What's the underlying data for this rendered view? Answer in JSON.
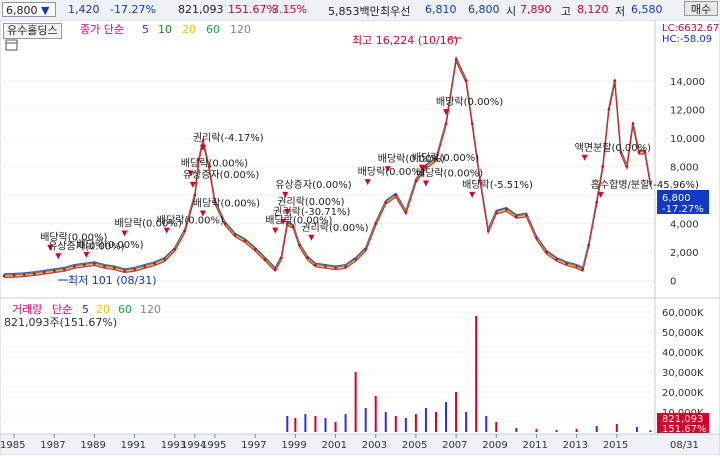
{
  "toolbar": {
    "price": "6,800",
    "change": "1,420",
    "change_pct": "-17.27%",
    "volume": "821,093",
    "vol_ratio": "151.67%",
    "turnover": "3.15%",
    "amount": "5,853백만",
    "bid_label": "최우선",
    "bid1": "6,810",
    "bid2": "6,800",
    "open_label": "시",
    "open": "7,890",
    "high_label": "고",
    "high": "8,120",
    "low_label": "저",
    "low": "6,580"
  },
  "buy_button": "매수",
  "stock_name": "유수홀딩스",
  "legend": {
    "price_title": "종가 단순",
    "ma": [
      "5",
      "10",
      "20",
      "60",
      "120"
    ],
    "ma_colors": [
      "#2f2fe0",
      "#1a8a1a",
      "#e3c600",
      "#16a34a",
      "#888888"
    ],
    "volume_title": "거래량",
    "volume_ma_label": "단순",
    "volume_ma": [
      "5",
      "20",
      "60",
      "120"
    ],
    "volume_summary": "821,093주(151.67%)"
  },
  "lc_hc": {
    "lc": "LC:6632.67",
    "hc": "HC:-58.09"
  },
  "current_price_tag": {
    "price": "6,800",
    "pct": "-17.27%"
  },
  "current_volume_tag": {
    "value": "821,093",
    "pct": "151.67%"
  },
  "annotations": {
    "high": "최고 16,224 (10/16)",
    "low": "최저 101 (08/31)",
    "events": [
      {
        "text": "권리락(-4.17%)",
        "year": 1994.4,
        "price": 9800
      },
      {
        "text": "배당락(0.00%)",
        "year": 1993.8,
        "price": 8000
      },
      {
        "text": "유상증자(0.00%)",
        "year": 1993.9,
        "price": 7200
      },
      {
        "text": "배당락(0.00%)",
        "year": 1994.4,
        "price": 5200
      },
      {
        "text": "배당락(0.00%)",
        "year": 1992.6,
        "price": 4000
      },
      {
        "text": "배당락(0.00%)",
        "year": 1990.5,
        "price": 3800
      },
      {
        "text": "배당락(0.00%)",
        "year": 1986.8,
        "price": 2800
      },
      {
        "text": "유상증자(0.00%)",
        "year": 1987.2,
        "price": 2200
      },
      {
        "text": "배당락(0.00%)",
        "year": 1988.6,
        "price": 2300
      },
      {
        "text": "유상증자(0.00%)",
        "year": 1998.5,
        "price": 6500
      },
      {
        "text": "권리락(0.00%)",
        "year": 1998.6,
        "price": 5300
      },
      {
        "text": "권리락(-30.71%)",
        "year": 1998.4,
        "price": 4600
      },
      {
        "text": "배당락(0.00%)",
        "year": 1998.0,
        "price": 4000
      },
      {
        "text": "권리락(0.00%)",
        "year": 1999.8,
        "price": 3500
      },
      {
        "text": "배당락(0.00%)",
        "year": 2002.6,
        "price": 7400
      },
      {
        "text": "배당락(0.00%)",
        "year": 2003.6,
        "price": 8300
      },
      {
        "text": "배당락(0.00%)",
        "year": 2005.3,
        "price": 8400
      },
      {
        "text": "배당락(0.00%)",
        "year": 2005.5,
        "price": 7300
      },
      {
        "text": "배당락(0.00%)",
        "year": 2006.5,
        "price": 12300
      },
      {
        "text": "배당락(-5.51%)",
        "year": 2007.8,
        "price": 6500
      },
      {
        "text": "흡수합병/분할(-45.96%)",
        "year": 2014.2,
        "price": 6500
      },
      {
        "text": "액면분할(0.00%)",
        "year": 2013.4,
        "price": 9100
      }
    ]
  },
  "chart_data": {
    "type": "line",
    "title": "",
    "x_label_years": [
      "1985",
      "1987",
      "1989",
      "1991",
      "1993",
      "1994",
      "1995",
      "1997",
      "1999",
      "2001",
      "2003",
      "2005",
      "2007",
      "2009",
      "2011",
      "2013",
      "2015"
    ],
    "x_last_label": "08/31",
    "price_axis": {
      "ticks": [
        0,
        2000,
        4000,
        6000,
        8000,
        10000,
        12000,
        14000
      ],
      "labels": [
        "0",
        "2,000",
        "4,000",
        "6,000",
        "8,000",
        "10,000",
        "12,000",
        "14,000"
      ],
      "range": [
        -1000,
        17000
      ]
    },
    "volume_axis": {
      "ticks": [
        5000000,
        10000000,
        20000000,
        30000000,
        40000000,
        50000000,
        60000000
      ],
      "labels": [
        "5,000K",
        "10,000K",
        "20,000K",
        "30,000K",
        "40,000K",
        "50,000K",
        "60,000K"
      ],
      "range": [
        0,
        66000000
      ]
    },
    "price_series": {
      "name": "",
      "x": [
        1984.5,
        1985.0,
        1985.5,
        1986.0,
        1986.5,
        1987.0,
        1987.5,
        1988.0,
        1988.5,
        1989.0,
        1989.5,
        1990.0,
        1990.5,
        1991.0,
        1991.5,
        1992.0,
        1992.5,
        1993.0,
        1993.5,
        1994.0,
        1994.2,
        1994.4,
        1994.7,
        1995.0,
        1995.5,
        1996.0,
        1996.5,
        1997.0,
        1997.5,
        1998.0,
        1998.3,
        1998.6,
        1998.9,
        1999.2,
        1999.6,
        2000.0,
        2000.5,
        2001.0,
        2001.5,
        2002.0,
        2002.5,
        2003.0,
        2003.5,
        2004.0,
        2004.5,
        2005.0,
        2005.5,
        2006.0,
        2006.5,
        2007.0,
        2007.5,
        2007.8,
        2008.2,
        2008.6,
        2009.0,
        2009.5,
        2010.0,
        2010.5,
        2011.0,
        2011.5,
        2012.0,
        2012.5,
        2013.0,
        2013.3,
        2013.6,
        2014.0,
        2014.3,
        2014.6,
        2014.9,
        2015.2,
        2015.5,
        2015.8,
        2016.1,
        2016.4,
        2016.67
      ],
      "y": [
        350,
        380,
        420,
        500,
        600,
        700,
        800,
        1000,
        1100,
        1200,
        1000,
        900,
        700,
        800,
        1000,
        1200,
        1500,
        2200,
        3500,
        6000,
        8500,
        9800,
        8000,
        5500,
        4000,
        3200,
        2800,
        2200,
        1500,
        800,
        1600,
        4000,
        3800,
        2500,
        1600,
        1100,
        1000,
        900,
        1000,
        1500,
        2200,
        4000,
        5500,
        6000,
        4800,
        7000,
        8000,
        8500,
        11000,
        15500,
        14000,
        11000,
        7000,
        3500,
        4800,
        5000,
        4500,
        4600,
        3000,
        2000,
        1500,
        1200,
        1000,
        800,
        2500,
        5500,
        8000,
        12000,
        14000,
        9000,
        8000,
        11000,
        9000,
        9000,
        6800
      ]
    },
    "volume_series": {
      "name": "",
      "x": [
        1998.6,
        1999.0,
        1999.5,
        2000.0,
        2000.5,
        2001.0,
        2001.5,
        2002.0,
        2002.5,
        2003.0,
        2003.5,
        2004.0,
        2004.5,
        2005.0,
        2005.5,
        2006.0,
        2006.5,
        2007.0,
        2007.5,
        2008.0,
        2008.5,
        2009.0,
        2010.0,
        2011.0,
        2012.0,
        2013.0,
        2014.0,
        2015.0,
        2016.0,
        2016.67
      ],
      "y": [
        8000000,
        7000000,
        9000000,
        8000000,
        7000000,
        5000000,
        9000000,
        30000000,
        12000000,
        18000000,
        10000000,
        8000000,
        7000000,
        9000000,
        12000000,
        10000000,
        15000000,
        20000000,
        10000000,
        58000000,
        8000000,
        5000000,
        2000000,
        1500000,
        1000000,
        1500000,
        3000000,
        4000000,
        2500000,
        821093
      ]
    }
  }
}
